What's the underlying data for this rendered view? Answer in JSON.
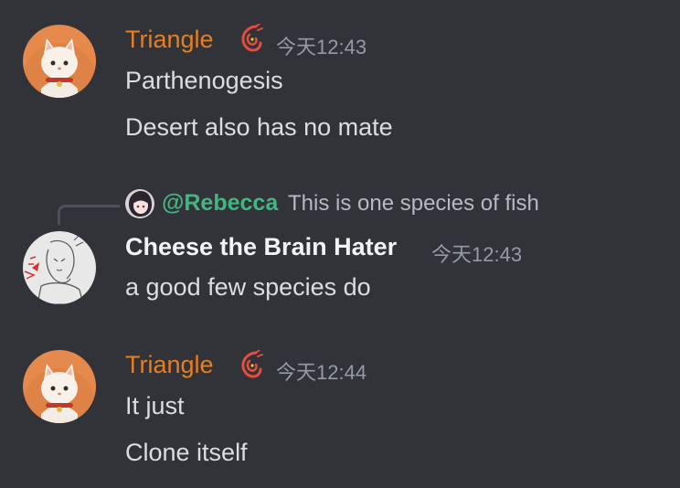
{
  "colors": {
    "background": "#313338",
    "triangle_name": "#e67e22",
    "cheese_name": "#f2f3f5",
    "mention": "#43b581",
    "timestamp": "#949ba4",
    "message": "#dbdee1"
  },
  "messages": [
    {
      "author": "Triangle",
      "role_icon": "flame-fish-icon",
      "timestamp": "今天12:43",
      "lines": [
        "Parthenogesis",
        "Desert also has no mate"
      ]
    },
    {
      "author": "Cheese the Brain Hater",
      "timestamp": "今天12:43",
      "reply": {
        "mention": "@Rebecca",
        "text": "This is one species of fish"
      },
      "lines": [
        "a good few species do"
      ]
    },
    {
      "author": "Triangle",
      "role_icon": "flame-fish-icon",
      "timestamp": "今天12:44",
      "lines": [
        "It just",
        "Clone itself"
      ]
    }
  ]
}
